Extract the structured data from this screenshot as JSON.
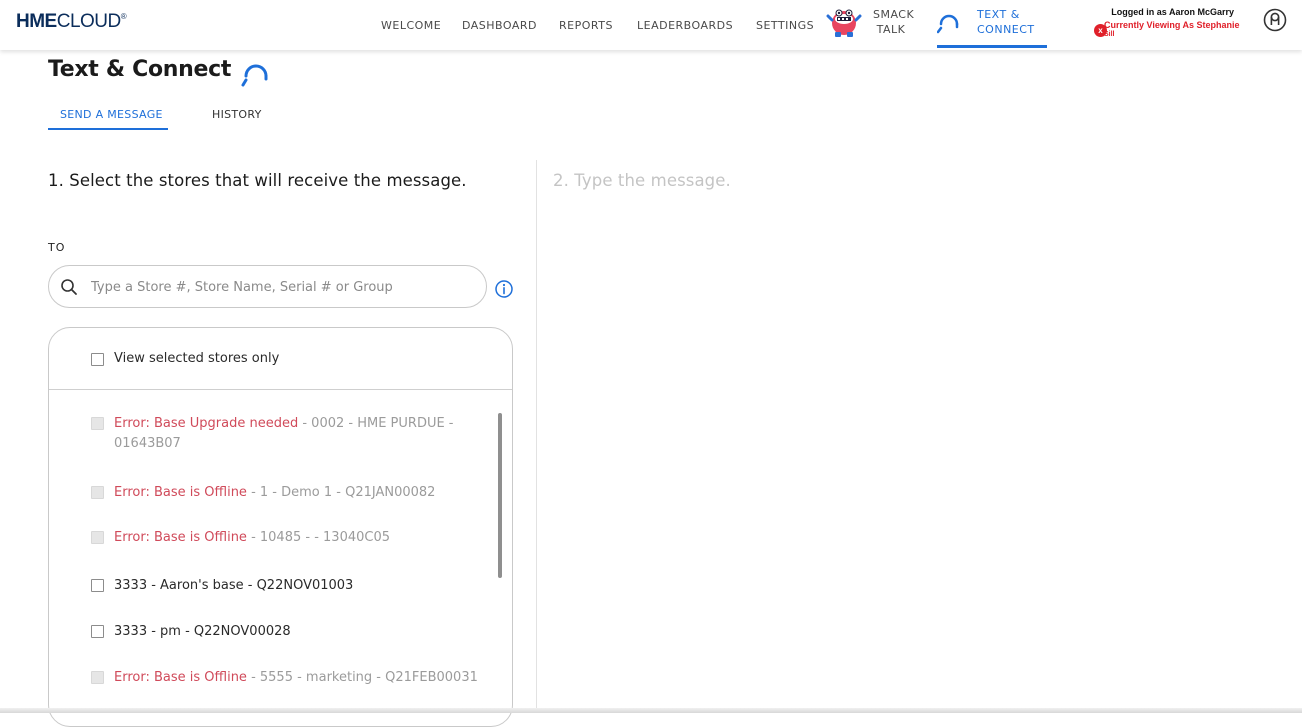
{
  "app": {
    "logo_bold": "HME",
    "logo_light": "CLOUD",
    "logo_reg": "®"
  },
  "nav": {
    "welcome": "WELCOME",
    "dashboard": "DASHBOARD",
    "reports": "REPORTS",
    "leaderboards": "LEADERBOARDS",
    "settings": "SETTINGS",
    "smack_line1": "SMACK",
    "smack_line2": "TALK",
    "text_line1": "TEXT &",
    "text_line2": "CONNECT",
    "active": "TEXT & CONNECT"
  },
  "user": {
    "logged_in": "Logged in as Aaron McGarry",
    "viewing_line1": "Currently Viewing As Stephanie",
    "viewing_line2": "Sill",
    "badge": "x"
  },
  "page": {
    "title": "Text & Connect",
    "tabs": [
      {
        "label": "SEND A MESSAGE",
        "active": true
      },
      {
        "label": "HISTORY",
        "active": false
      }
    ],
    "step1": "1. Select the stores that will receive the message.",
    "step2": "2. Type the message.",
    "to_label": "TO"
  },
  "search": {
    "placeholder": "Type a Store #, Store Name, Serial # or Group",
    "value": ""
  },
  "stores": {
    "view_selected_label": "View selected stores only",
    "items": [
      {
        "error": "Error: Base Upgrade needed",
        "rest": " - 0002 - HME PURDUE - 01643B07",
        "disabled": true
      },
      {
        "error": "Error: Base is Offline",
        "rest": " - 1 - Demo 1 - Q21JAN00082",
        "disabled": true
      },
      {
        "error": "Error: Base is Offline",
        "rest": " - 10485 - - 13040C05",
        "disabled": true
      },
      {
        "error": "",
        "rest": "3333 - Aaron's base - Q22NOV01003",
        "disabled": false
      },
      {
        "error": "",
        "rest": "3333 - pm - Q22NOV00028",
        "disabled": false
      },
      {
        "error": "Error: Base is Offline",
        "rest": " - 5555 - marketing - Q21FEB00031",
        "disabled": true
      }
    ]
  },
  "colors": {
    "accent": "#1e6fd9",
    "error": "#d04a5a",
    "alert_red": "#e0202a",
    "logo_navy": "#0b2d5b"
  }
}
